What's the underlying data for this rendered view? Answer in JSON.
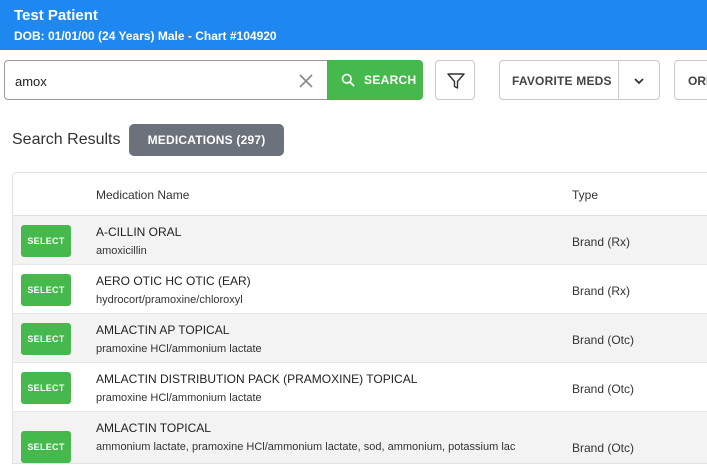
{
  "patient": {
    "name": "Test Patient",
    "details": "DOB: 01/01/00 (24 Years) Male - Chart #104920"
  },
  "search": {
    "value": "amox",
    "button_label": "SEARCH"
  },
  "toolbar": {
    "favorite_label": "FAVORITE MEDS",
    "order_label_partial": "ORI"
  },
  "results": {
    "label": "Search Results",
    "tab_label": "MEDICATIONS (297)",
    "columns": {
      "name": "Medication Name",
      "type": "Type"
    },
    "select_label": "SELECT",
    "rows": [
      {
        "name": "A-CILLIN ORAL",
        "generic": "amoxicillin",
        "type": "Brand (Rx)"
      },
      {
        "name": "AERO OTIC HC OTIC (EAR)",
        "generic": "hydrocort/pramoxine/chloroxyl",
        "type": "Brand (Rx)"
      },
      {
        "name": "AMLACTIN AP TOPICAL",
        "generic": "pramoxine HCl/ammonium lactate",
        "type": "Brand (Otc)"
      },
      {
        "name": "AMLACTIN DISTRIBUTION PACK (PRAMOXINE) TOPICAL",
        "generic": "pramoxine HCl/ammonium lactate",
        "type": "Brand (Otc)"
      },
      {
        "name": "AMLACTIN TOPICAL",
        "generic": "ammonium lactate, pramoxine HCl/ammonium lactate, sod, ammonium, potassium lac",
        "type": "Brand (Otc)"
      }
    ]
  },
  "colors": {
    "header": "#1e88f0",
    "accent_green": "#46b94d",
    "tab_gray": "#6c727b"
  }
}
